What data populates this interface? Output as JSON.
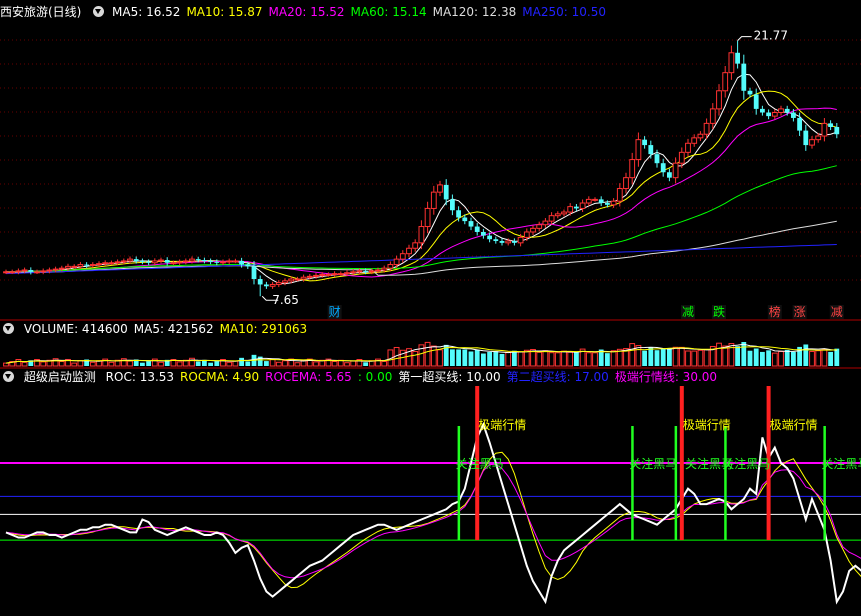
{
  "chart_data": [
    {
      "type": "candlestick",
      "title": "西安旅游(日线)",
      "ma_labels": [
        {
          "name": "MA5",
          "value": "16.52",
          "color": "#ffffff"
        },
        {
          "name": "MA10",
          "value": "15.87",
          "color": "#ffff00"
        },
        {
          "name": "MA20",
          "value": "15.52",
          "color": "#ff00ff"
        },
        {
          "name": "MA60",
          "value": "15.14",
          "color": "#00ff00"
        },
        {
          "name": "MA120",
          "value": "12.38",
          "color": "#dddddd"
        },
        {
          "name": "MA250",
          "value": "10.50",
          "color": "#2222ff"
        }
      ],
      "high_label": "21.77",
      "low_label": "7.65",
      "high_value": 21.77,
      "low_value": 7.65,
      "badges": [
        {
          "text": "财",
          "color": "#00aaff",
          "index": 53
        },
        {
          "text": "减",
          "color": "#00ff00",
          "index": 110
        },
        {
          "text": "跌",
          "color": "#00ff00",
          "index": 115
        },
        {
          "text": "榜",
          "color": "#ff4444",
          "index": 124
        },
        {
          "text": "涨",
          "color": "#ff4444",
          "index": 128
        },
        {
          "text": "减",
          "color": "#ff4444",
          "index": 134
        }
      ],
      "closes": [
        9.0,
        9.0,
        9.05,
        9.1,
        9.0,
        9.0,
        9.05,
        9.1,
        9.15,
        9.2,
        9.3,
        9.3,
        9.4,
        9.35,
        9.4,
        9.45,
        9.5,
        9.5,
        9.55,
        9.6,
        9.7,
        9.6,
        9.55,
        9.5,
        9.6,
        9.65,
        9.5,
        9.5,
        9.55,
        9.6,
        9.7,
        9.65,
        9.6,
        9.55,
        9.5,
        9.55,
        9.6,
        9.6,
        9.4,
        9.3,
        8.6,
        8.3,
        8.2,
        8.3,
        8.4,
        8.5,
        8.6,
        8.6,
        8.7,
        8.75,
        8.8,
        8.85,
        8.85,
        8.9,
        8.9,
        8.95,
        9.0,
        9.05,
        9.0,
        9.05,
        9.1,
        9.2,
        9.4,
        9.7,
        10.0,
        10.3,
        10.6,
        11.5,
        12.5,
        13.4,
        13.8,
        13.0,
        12.4,
        12.0,
        11.8,
        11.5,
        11.2,
        11.0,
        10.8,
        10.7,
        10.6,
        10.7,
        10.6,
        10.9,
        11.2,
        11.4,
        11.6,
        11.8,
        12.1,
        12.2,
        12.3,
        12.6,
        12.5,
        12.8,
        13.0,
        13.0,
        12.8,
        12.7,
        12.9,
        13.6,
        14.2,
        15.2,
        16.3,
        16.0,
        15.5,
        15.0,
        14.5,
        14.2,
        15.0,
        15.6,
        16.1,
        16.4,
        16.6,
        17.2,
        18.0,
        19.0,
        20.0,
        21.1,
        20.5,
        19.0,
        18.8,
        18.0,
        17.8,
        17.6,
        17.8,
        18.0,
        17.8,
        17.5,
        16.8,
        16.0,
        16.3,
        16.5,
        17.2,
        17.0,
        16.6
      ]
    },
    {
      "type": "bar",
      "title": "VOLUME",
      "labels": [
        {
          "name": "VOLUME",
          "value": "414600",
          "color": "#ffffff"
        },
        {
          "name": "MA5",
          "value": "421562",
          "color": "#ffffff"
        },
        {
          "name": "MA10",
          "value": "291063",
          "color": "#ffff00"
        }
      ]
    },
    {
      "type": "line",
      "title": "超级启动监测",
      "labels": [
        {
          "name": "ROC",
          "value": "13.53",
          "color": "#ffffff"
        },
        {
          "name": "ROCMA",
          "value": "4.90",
          "color": "#ffff00"
        },
        {
          "name": "ROCEMA",
          "value": "5.65",
          "color": "#ff00ff"
        },
        {
          "name": "",
          "value": "0.00",
          "color": "#00ff00"
        },
        {
          "name": "第一超买线",
          "value": "10.00",
          "color": "#ffffff"
        },
        {
          "name": "第二超买线",
          "value": "17.00",
          "color": "#2222ff"
        },
        {
          "name": "极端行情线",
          "value": "30.00",
          "color": "#ff00ff"
        }
      ],
      "levels": [
        0,
        10,
        17,
        30
      ],
      "ylim": [
        -28,
        60
      ],
      "roc": [
        3,
        2,
        1,
        1,
        2,
        3,
        3,
        2,
        2,
        1,
        2,
        3,
        4,
        4,
        5,
        5,
        6,
        6,
        5,
        4,
        3,
        3,
        8,
        7,
        4,
        3,
        2,
        3,
        4,
        5,
        4,
        3,
        2,
        2,
        3,
        2,
        -1,
        -5,
        -3,
        -2,
        -8,
        -15,
        -20,
        -22,
        -20,
        -18,
        -16,
        -14,
        -12,
        -10,
        -9,
        -8,
        -6,
        -4,
        -2,
        0,
        2,
        3,
        4,
        5,
        6,
        6,
        5,
        4,
        5,
        6,
        7,
        8,
        9,
        10,
        11,
        12,
        14,
        15,
        20,
        30,
        40,
        45,
        38,
        30,
        22,
        14,
        6,
        -2,
        -10,
        -16,
        -20,
        -24,
        -14,
        -8,
        -4,
        -2,
        0,
        2,
        4,
        6,
        8,
        10,
        12,
        14,
        12,
        10,
        9,
        8,
        7,
        6,
        8,
        10,
        12,
        16,
        20,
        18,
        14,
        14,
        15,
        16,
        15,
        12,
        14,
        16,
        20,
        18,
        40,
        32,
        36,
        30,
        28,
        24,
        16,
        8,
        16,
        10,
        4,
        -8,
        -24,
        -20,
        -12,
        -10,
        -12,
        -16,
        -18,
        -20,
        -18,
        -16,
        -15,
        -14,
        -13
      ]
    }
  ],
  "annotations": {
    "extreme_label": "极端行情",
    "attention_label": "关注黑马",
    "signals": [
      {
        "type": "attention",
        "index": 73,
        "label_index": 73
      },
      {
        "type": "extreme",
        "index": 76,
        "label_index": 76
      },
      {
        "type": "attention",
        "index": 101,
        "label_index": 101
      },
      {
        "type": "attention",
        "index": 108,
        "label_index": 110
      },
      {
        "type": "extreme",
        "index": 109,
        "label_index": 109
      },
      {
        "type": "attention",
        "index": 116,
        "label_index": 116
      },
      {
        "type": "extreme",
        "index": 123,
        "label_index": 123
      },
      {
        "type": "attention",
        "index": 132,
        "label_index": 132
      }
    ]
  }
}
